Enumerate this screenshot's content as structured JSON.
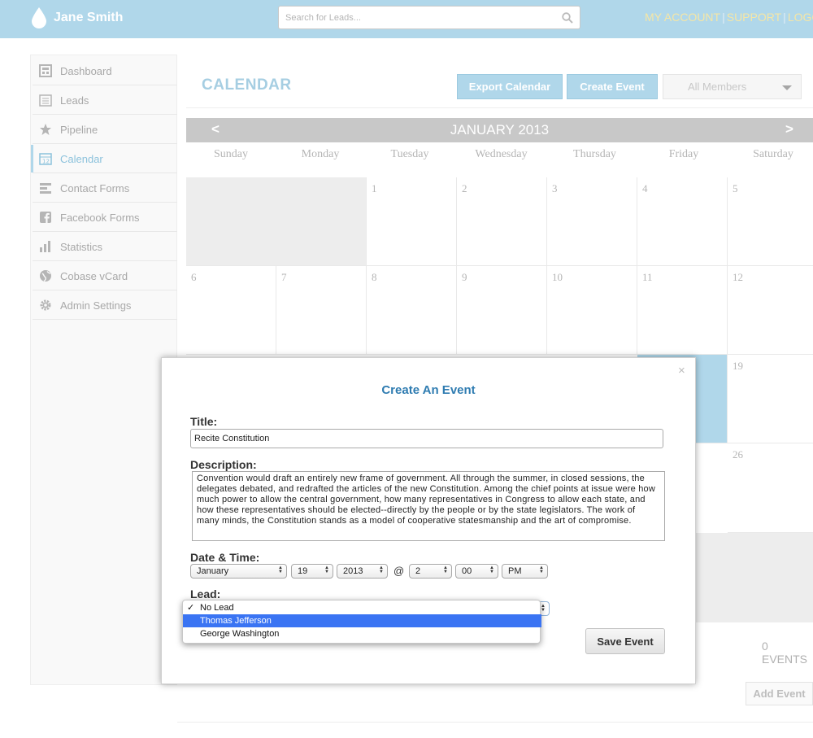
{
  "header": {
    "user_name": "Jane Smith",
    "search_placeholder": "Search for Leads...",
    "links": [
      "MY ACCOUNT",
      "SUPPORT",
      "LOGO"
    ]
  },
  "sidebar": {
    "items": [
      {
        "label": "Dashboard",
        "icon": "dashboard-icon"
      },
      {
        "label": "Leads",
        "icon": "leads-icon"
      },
      {
        "label": "Pipeline",
        "icon": "star-icon"
      },
      {
        "label": "Calendar",
        "icon": "calendar-icon",
        "active": true
      },
      {
        "label": "Contact Forms",
        "icon": "forms-icon"
      },
      {
        "label": "Facebook Forms",
        "icon": "facebook-icon"
      },
      {
        "label": "Statistics",
        "icon": "bar-chart-icon"
      },
      {
        "label": "Cobase vCard",
        "icon": "globe-icon"
      },
      {
        "label": "Admin Settings",
        "icon": "gear-icon"
      }
    ]
  },
  "main": {
    "title": "CALENDAR",
    "export_label": "Export Calendar",
    "create_label": "Create Event",
    "members_label": "All Members",
    "events_count": "0 EVENTS",
    "add_event_label": "Add Event"
  },
  "calendar": {
    "month_label": "JANUARY 2013",
    "prev": "<",
    "next": ">",
    "weekdays": [
      "Sunday",
      "Monday",
      "Tuesday",
      "Wednesday",
      "Thursday",
      "Friday",
      "Saturday"
    ],
    "visible_days": [
      "1",
      "2",
      "3",
      "4",
      "5",
      "6",
      "7",
      "8",
      "9",
      "10",
      "11",
      "12",
      "19",
      "26"
    ]
  },
  "modal": {
    "close": "×",
    "title": "Create An Event",
    "title_label": "Title:",
    "title_value": "Recite Constitution",
    "desc_label": "Description:",
    "desc_value": "Convention would draft an entirely new frame of government. All through the summer, in closed sessions, the delegates debated, and redrafted the articles of the new Constitution. Among the chief points at issue were how much power to allow the central government, how many representatives in Congress to allow each state, and how these representatives should be elected--directly by the people or by the state legislators. The work of many minds, the Constitution stands as a model of cooperative statesmanship and the art of compromise.",
    "date_label": "Date & Time:",
    "month": "January",
    "day": "19",
    "year": "2013",
    "at": "@",
    "hour": "2",
    "minute": "00",
    "ampm": "PM",
    "lead_label": "Lead:",
    "lead_options": [
      "No Lead",
      "Thomas Jefferson",
      "George Washington"
    ],
    "check": "✓",
    "save_label": "Save Event"
  }
}
